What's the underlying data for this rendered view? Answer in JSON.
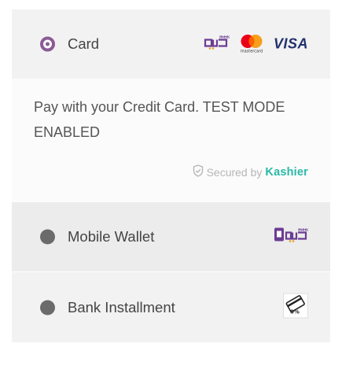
{
  "methods": {
    "card": {
      "label": "Card",
      "selected": true,
      "logos": [
        "meeza-logo",
        "mastercard-logo",
        "visa-logo"
      ],
      "mastercard_text": "mastercard",
      "visa_text": "VISA"
    },
    "card_description": {
      "text": "Pay with your Credit Card. TEST MODE ENABLED",
      "secured_prefix": "Secured by",
      "secured_brand": "Kashier"
    },
    "wallet": {
      "label": "Mobile Wallet",
      "selected": false,
      "logo": "meeza-wallet-logo"
    },
    "bank": {
      "label": "Bank Installment",
      "selected": false,
      "logo": "installment-card-logo"
    }
  },
  "colors": {
    "radio_selected": "#8a5b93",
    "radio_unselected": "#6b6b6b",
    "kashier_brand": "#2bb8a8",
    "visa_blue": "#21316e",
    "meeza_purple": "#6b3c93"
  }
}
